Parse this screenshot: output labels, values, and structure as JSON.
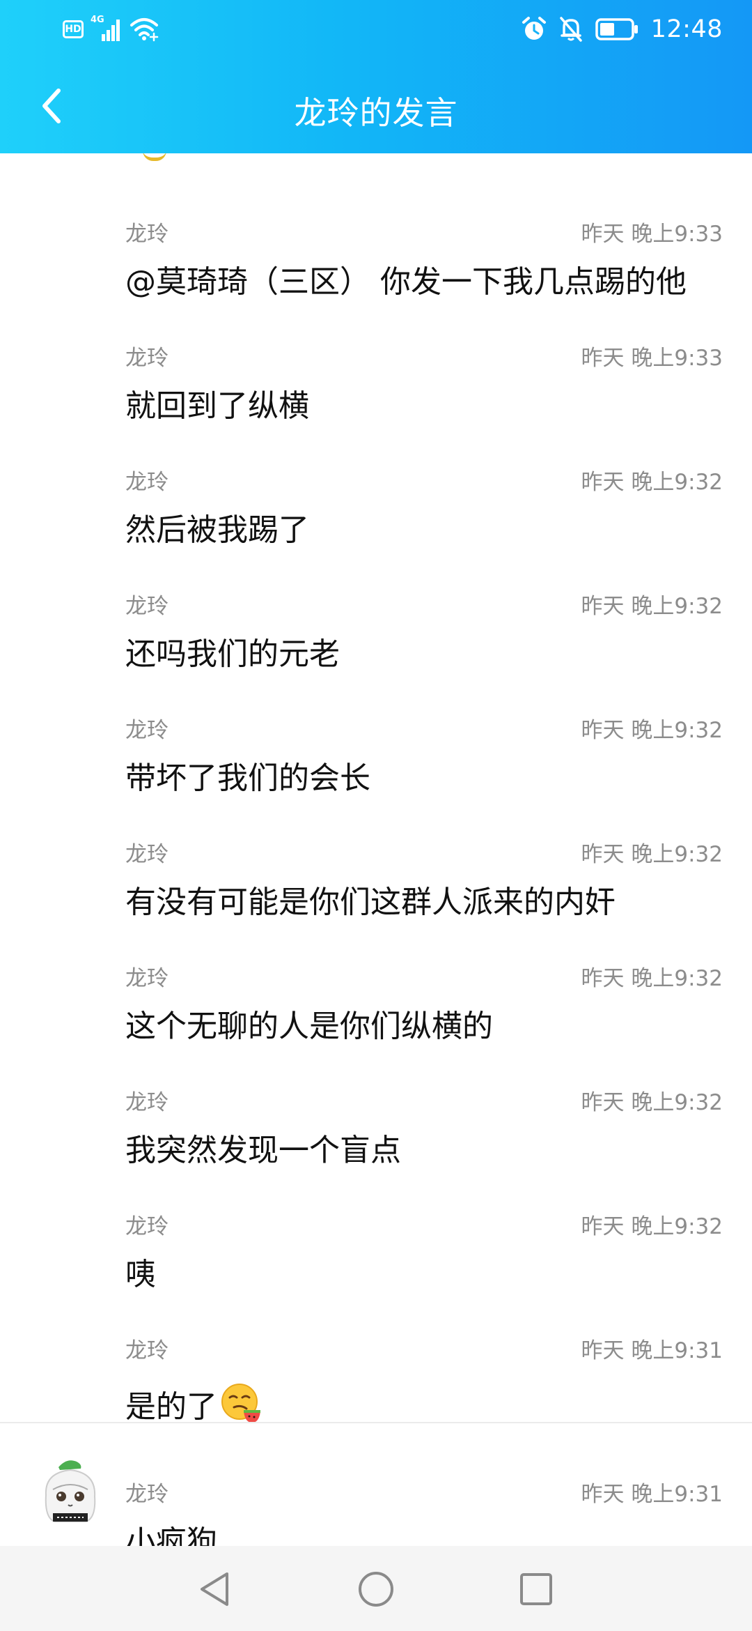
{
  "status_bar": {
    "badge": "HD",
    "network": "4G",
    "time": "12:48",
    "icons": [
      "hd-icon",
      "signal-icon",
      "wifi-icon",
      "alarm-icon",
      "mute-icon",
      "battery-icon"
    ]
  },
  "header": {
    "title": "龙玲的发言",
    "back_icon": "chevron-left-icon",
    "gradient": [
      "#1fd0fa",
      "#1498f6"
    ]
  },
  "messages": [
    {
      "sender": "龙玲",
      "time": "昨天 晚上9:33",
      "text": "@莫琦琦（三区） 你发一下我几点踢的他"
    },
    {
      "sender": "龙玲",
      "time": "昨天 晚上9:33",
      "text": "就回到了纵横"
    },
    {
      "sender": "龙玲",
      "time": "昨天 晚上9:32",
      "text": "然后被我踢了"
    },
    {
      "sender": "龙玲",
      "time": "昨天 晚上9:32",
      "text": "还吗我们的元老"
    },
    {
      "sender": "龙玲",
      "time": "昨天 晚上9:32",
      "text": "带坏了我们的会长"
    },
    {
      "sender": "龙玲",
      "time": "昨天 晚上9:32",
      "text": "有没有可能是你们这群人派来的内奸"
    },
    {
      "sender": "龙玲",
      "time": "昨天 晚上9:32",
      "text": "这个无聊的人是你们纵横的"
    },
    {
      "sender": "龙玲",
      "time": "昨天 晚上9:32",
      "text": "我突然发现一个盲点"
    },
    {
      "sender": "龙玲",
      "time": "昨天 晚上9:32",
      "text": "咦"
    },
    {
      "sender": "龙玲",
      "time": "昨天 晚上9:31",
      "text": "是的了",
      "emoji": "watermelon-smirk-emoji"
    },
    {
      "sender": "龙玲",
      "time": "昨天 晚上9:31",
      "text": "小疯狗",
      "avatar": "anime-girl-avatar"
    }
  ],
  "nav_bar": {
    "buttons": [
      "back-triangle-icon",
      "home-circle-icon",
      "recents-square-icon"
    ]
  }
}
